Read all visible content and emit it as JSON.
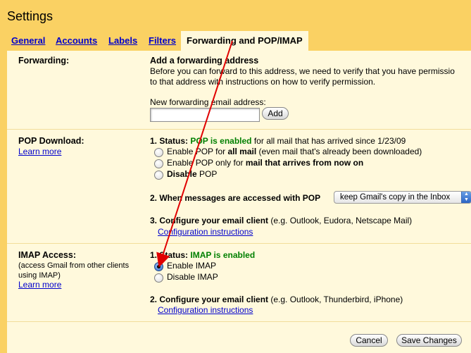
{
  "page": {
    "title": "Settings"
  },
  "tabs": [
    {
      "label": "General"
    },
    {
      "label": "Accounts"
    },
    {
      "label": "Labels"
    },
    {
      "label": "Filters"
    },
    {
      "label": "Forwarding and POP/IMAP"
    }
  ],
  "forwarding": {
    "label": "Forwarding:",
    "heading": "Add a forwarding address",
    "desc1": "Before you can forward to this address, we need to verify that you have permissio",
    "desc2": "to that address with instructions on how to verify permission.",
    "field_label": "New forwarding email address:",
    "field_value": "",
    "add_label": "Add"
  },
  "pop": {
    "label": "POP Download:",
    "learn_more": "Learn more",
    "status_prefix": "1. Status: ",
    "status_value": "POP is enabled",
    "status_suffix": " for all mail that has arrived since 1/23/09",
    "opt1_pre": "Enable POP for ",
    "opt1_bold": "all mail",
    "opt1_post": " (even mail that's already been downloaded)",
    "opt2_pre": "Enable POP only for ",
    "opt2_bold": "mail that arrives from now on",
    "opt3_bold": "Disable",
    "opt3_post": " POP",
    "access_label": "2. When messages are accessed with POP",
    "access_select": "keep Gmail's copy in the Inbox",
    "config_bold": "3. Configure your email client",
    "config_rest": " (e.g. Outlook, Eudora, Netscape Mail)",
    "config_link": "Configuration instructions"
  },
  "imap": {
    "label": "IMAP Access:",
    "sub": "(access Gmail from other clients using IMAP)",
    "learn_more": "Learn more",
    "status_prefix": "1. Status: ",
    "status_value": "IMAP is enabled",
    "opt_enable": "Enable IMAP",
    "opt_disable": "Disable IMAP",
    "enabled": true,
    "config_bold": "2. Configure your email client",
    "config_rest": " (e.g. Outlook, Thunderbird, iPhone)",
    "config_link": "Configuration instructions"
  },
  "footer": {
    "cancel": "Cancel",
    "save": "Save Changes"
  },
  "annotation": {
    "color": "#e00000"
  }
}
